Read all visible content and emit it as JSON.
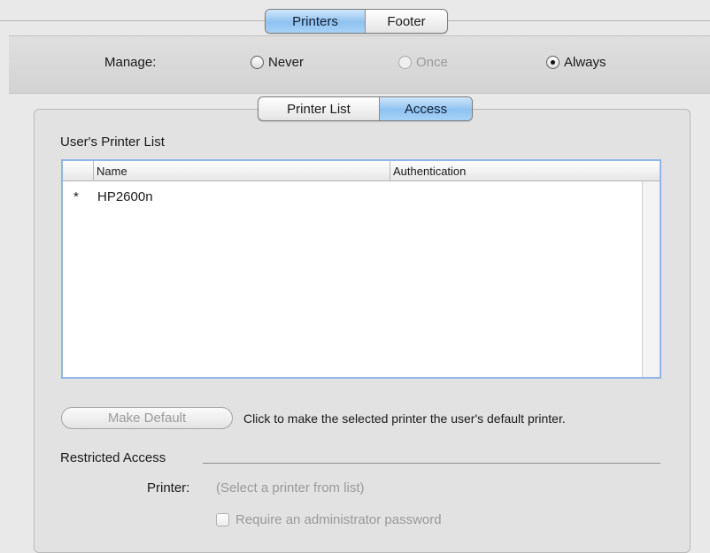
{
  "top_tabs": {
    "items": [
      "Printers",
      "Footer"
    ],
    "active": "Printers"
  },
  "manage": {
    "label": "Manage:",
    "options": [
      {
        "label": "Never",
        "selected": false,
        "enabled": true
      },
      {
        "label": "Once",
        "selected": false,
        "enabled": false
      },
      {
        "label": "Always",
        "selected": true,
        "enabled": true
      }
    ]
  },
  "sub_tabs": {
    "items": [
      "Printer List",
      "Access"
    ],
    "active": "Access"
  },
  "printer_list": {
    "title": "User's Printer List",
    "columns": [
      "Name",
      "Authentication"
    ],
    "rows": [
      {
        "default_mark": "*",
        "name": "HP2600n",
        "authentication": ""
      }
    ]
  },
  "make_default": {
    "button_label": "Make Default",
    "help": "Click to make the selected printer the user's default printer."
  },
  "restricted_access": {
    "title": "Restricted Access",
    "printer_label": "Printer:",
    "printer_value": "(Select a printer from list)",
    "require_admin_label": "Require an administrator password"
  },
  "colors": {
    "selection_blue": "#8fc2f0",
    "focus_ring": "#8fb6e7"
  }
}
